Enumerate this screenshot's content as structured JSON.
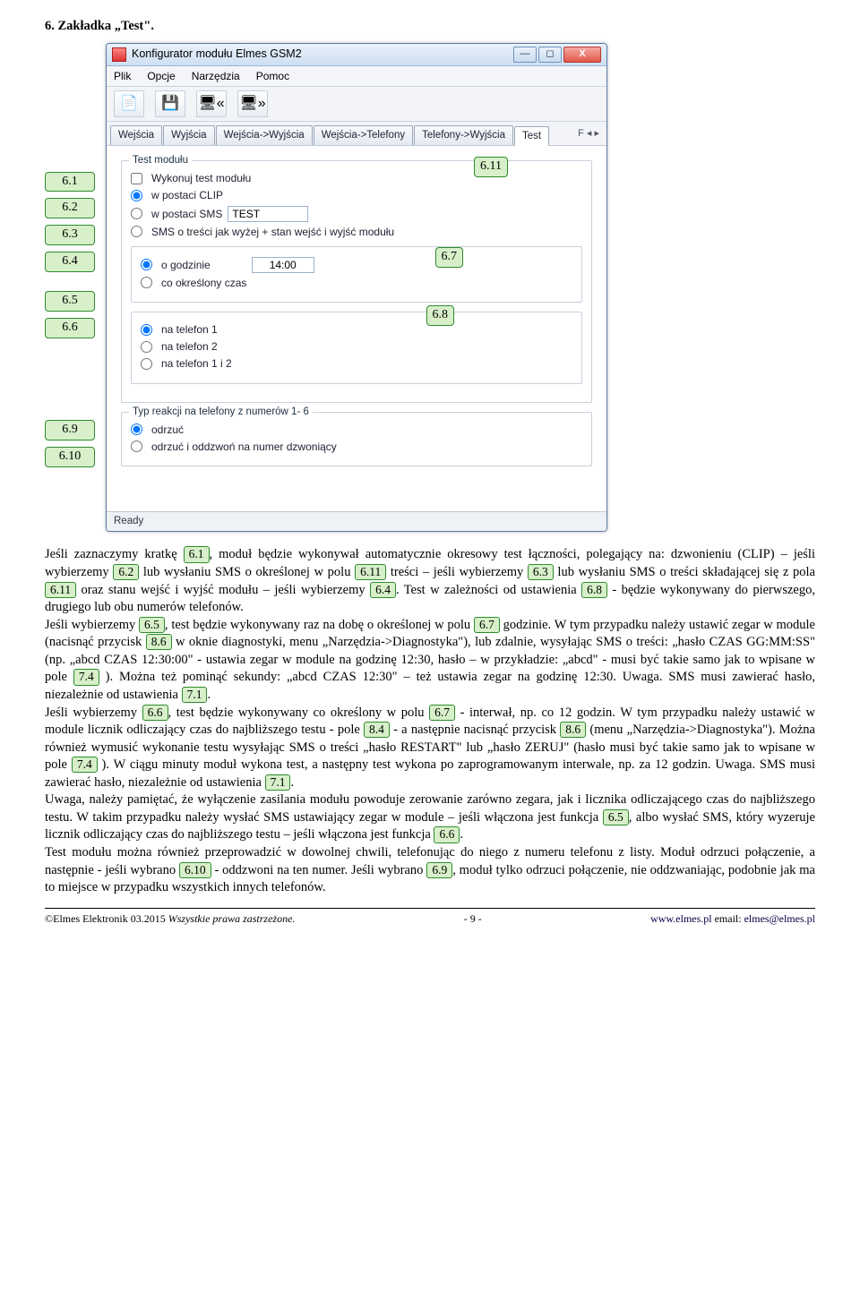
{
  "section": {
    "heading": "6.  Zakładka „Test\"."
  },
  "window": {
    "title": "Konfigurator modułu Elmes GSM2",
    "min": "—",
    "max": "◻",
    "close": "X",
    "menubar": [
      "Plik",
      "Opcje",
      "Narzędzia",
      "Pomoc"
    ],
    "tabs": [
      "Wejścia",
      "Wyjścia",
      "Wejścia->Wyjścia",
      "Wejścia->Telefony",
      "Telefony->Wyjścia",
      "Test"
    ],
    "tabnav": "F   ◂ ▸"
  },
  "pane": {
    "group1_legend": "Test modułu",
    "chk_wykonuj": "Wykonuj test modułu",
    "r_clip": "w postaci CLIP",
    "r_sms": "w postaci SMS",
    "sms_value": "TEST",
    "r_sms_stan": "SMS o treści jak wyżej + stan wejść i wyjść modułu",
    "grp2_r1": "o godzinie",
    "grp2_time": "14:00",
    "grp2_r2": "co określony czas",
    "grp3_r1": "na telefon 1",
    "grp3_r2": "na telefon 2",
    "grp3_r3": "na telefon 1 i 2",
    "grp4_legend": "Typ reakcji na telefony z numerów 1- 6",
    "grp4_r1": "odrzuć",
    "grp4_r2": "odrzuć i oddzwoń na numer dzwoniący",
    "status": "Ready"
  },
  "callouts": {
    "c61": "6.1",
    "c62": "6.2",
    "c63": "6.3",
    "c64": "6.4",
    "c65": "6.5",
    "c66": "6.6",
    "c67": "6.7",
    "c68": "6.8",
    "c69": "6.9",
    "c610": "6.10",
    "c611": "6.11"
  },
  "body": {
    "p1a": "Jeśli zaznaczymy kratkę ",
    "p1b": ", moduł będzie wykonywał automatycznie okresowy test łączności, polegający na: dzwonieniu (CLIP) – jeśli wybierzemy ",
    "p1c": " lub wysłaniu SMS o określonej w polu ",
    "p1d": " treści – jeśli wybierzemy ",
    "p1e": " lub wysłaniu SMS o treści składającej się z pola ",
    "p1f": " oraz stanu wejść i wyjść modułu – jeśli wybierzemy ",
    "p1g": ". Test w zależności od ustawienia ",
    "p1h": " - będzie wykonywany do pierwszego, drugiego lub obu numerów telefonów.",
    "p2a": "Jeśli wybierzemy ",
    "p2b": ", test będzie wykonywany raz na dobę o określonej w polu ",
    "p2c": " godzinie. W tym przypadku należy ustawić zegar w module (nacisnąć przycisk ",
    "p2d": " w oknie diagnostyki, menu „Narzędzia->Diagnostyka\"), lub zdalnie, wysyłając SMS o treści: „hasło CZAS GG:MM:SS\" (np. „abcd CZAS 12:30:00\" - ustawia zegar w module na godzinę 12:30, hasło – w przykładzie: „abcd\" - musi być takie samo jak to wpisane w pole ",
    "p2e": " ). Można też pominąć sekundy: „abcd CZAS 12:30\" – też ustawia zegar na godzinę 12:30. Uwaga. SMS musi zawierać hasło, niezależnie od ustawienia ",
    "p2f": ".",
    "p3a": "Jeśli wybierzemy ",
    "p3b": ", test będzie wykonywany co określony w polu ",
    "p3c": " - interwał, np. co 12 godzin. W tym przypadku należy ustawić w module licznik odliczający czas do najbliższego testu - pole ",
    "p3d": " - a następnie nacisnąć przycisk ",
    "p3e": " (menu „Narzędzia->Diagnostyka\"). Można również wymusić wykonanie testu wysyłając SMS o treści „hasło RESTART\" lub „hasło ZERUJ\" (hasło musi być takie samo jak to wpisane w pole ",
    "p3f": " ). W ciągu minuty moduł wykona test, a następny test wykona po zaprogramowanym interwale, np. za 12 godzin. Uwaga. SMS musi zawierać hasło, niezależnie od ustawienia ",
    "p3g": ".",
    "p4": "Uwaga, należy pamiętać, że wyłączenie zasilania modułu powoduje zerowanie zarówno zegara, jak i licznika odliczającego czas do najbliższego testu. W takim przypadku należy wysłać SMS ustawiający zegar w module – jeśli włączona jest funkcja ",
    "p4b": ", albo wysłać SMS, który wyzeruje licznik odliczający czas do najbliższego testu – jeśli włączona jest funkcja ",
    "p4c": ".",
    "p5a": "Test modułu można również przeprowadzić w dowolnej chwili, telefonując do niego z numeru telefonu z listy. Moduł odrzuci połączenie, a następnie - jeśli wybrano ",
    "p5b": " - oddzwoni na ten numer. Jeśli wybrano ",
    "p5c": ", moduł tylko odrzuci połączenie, nie oddzwaniając, podobnie jak ma to miejsce w przypadku wszystkich innych telefonów.",
    "r61": "6.1",
    "r62": "6.2",
    "r63": "6.3",
    "r64": "6.4",
    "r65": "6.5",
    "r66": "6.6",
    "r67": "6.7",
    "r68": "6.8",
    "r69": "6.9",
    "r610": "6.10",
    "r611": "6.11",
    "r71": "7.1",
    "r74": "7.4",
    "r84": "8.4",
    "r86": "8.6"
  },
  "footer": {
    "left_a": "©Elmes Elektronik 03.2015 ",
    "left_i": "Wszystkie prawa zastrzeżone.",
    "center": "- 9 -",
    "right_a": "www.elmes.pl",
    "right_b": "  email: ",
    "right_c": "elmes@elmes.pl"
  }
}
